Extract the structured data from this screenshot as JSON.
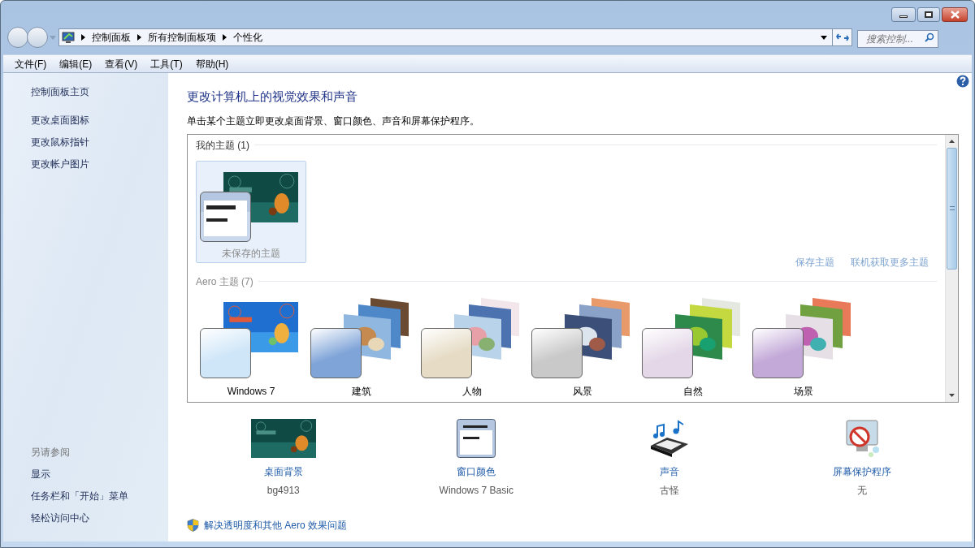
{
  "address_bar": {
    "path": [
      "控制面板",
      "所有控制面板项",
      "个性化"
    ]
  },
  "search": {
    "placeholder": "搜索控制..."
  },
  "menu": [
    "文件(F)",
    "编辑(E)",
    "查看(V)",
    "工具(T)",
    "帮助(H)"
  ],
  "sidebar": {
    "links": [
      "控制面板主页",
      "更改桌面图标",
      "更改鼠标指针",
      "更改帐户图片"
    ],
    "see_also": {
      "heading": "另请参阅",
      "links": [
        "显示",
        "任务栏和「开始」菜单",
        "轻松访问中心"
      ]
    }
  },
  "main": {
    "title": "更改计算机上的视觉效果和声音",
    "description": "单击某个主题立即更改桌面背景、窗口颜色、声音和屏幕保护程序。",
    "theme_sections": [
      {
        "heading": "我的主题 (1)",
        "items": [
          {
            "label": "未保存的主题",
            "kind": "basic",
            "selected": true,
            "color": "#b4c6e0"
          }
        ],
        "links": [
          "保存主题",
          "联机获取更多主题"
        ]
      },
      {
        "heading": "Aero 主题 (7)",
        "items": [
          {
            "label": "Windows 7",
            "kind": "aero",
            "selected": false,
            "color": "#cfe6f8"
          },
          {
            "label": "建筑",
            "kind": "aero",
            "selected": false,
            "color": "#7fa4d8"
          },
          {
            "label": "人物",
            "kind": "aero",
            "selected": false,
            "color": "#e6dcc6"
          },
          {
            "label": "风景",
            "kind": "aero",
            "selected": false,
            "color": "#c9c9c9"
          },
          {
            "label": "自然",
            "kind": "aero",
            "selected": false,
            "color": "#e4d8e8"
          },
          {
            "label": "场景",
            "kind": "aero",
            "selected": false,
            "color": "#c3a9d8"
          }
        ]
      }
    ]
  },
  "settings": [
    {
      "kind": "picture",
      "label": "桌面背景",
      "value": "bg4913"
    },
    {
      "kind": "window",
      "label": "窗口颜色",
      "value": "Windows 7 Basic"
    },
    {
      "kind": "sound",
      "label": "声音",
      "value": "古怪"
    },
    {
      "kind": "screensaver",
      "label": "屏幕保护程序",
      "value": "无"
    }
  ],
  "help_link": "解决透明度和其他 Aero 效果问题"
}
